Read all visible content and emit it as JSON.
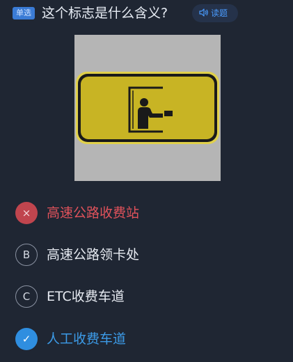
{
  "question": {
    "type_badge": "单选",
    "text": "这个标志是什么含义?",
    "read_button_label": "读题"
  },
  "sign": {
    "description_icon": "toll-booth-sign-icon",
    "colors": {
      "background": "#c8b424",
      "border": "#1a1a1a",
      "frame": "#e0d04a"
    }
  },
  "options": [
    {
      "marker": "×",
      "label": "高速公路收费站",
      "state": "wrong"
    },
    {
      "marker": "B",
      "label": "高速公路领卡处",
      "state": "normal"
    },
    {
      "marker": "C",
      "label": "ETC收费车道",
      "state": "normal"
    },
    {
      "marker": "✓",
      "label": "人工收费车道",
      "state": "correct"
    }
  ],
  "colors": {
    "page_background": "#1f2633",
    "wrong": "#e0525b",
    "correct": "#3c9be8",
    "accent": "#3a7bd5"
  }
}
